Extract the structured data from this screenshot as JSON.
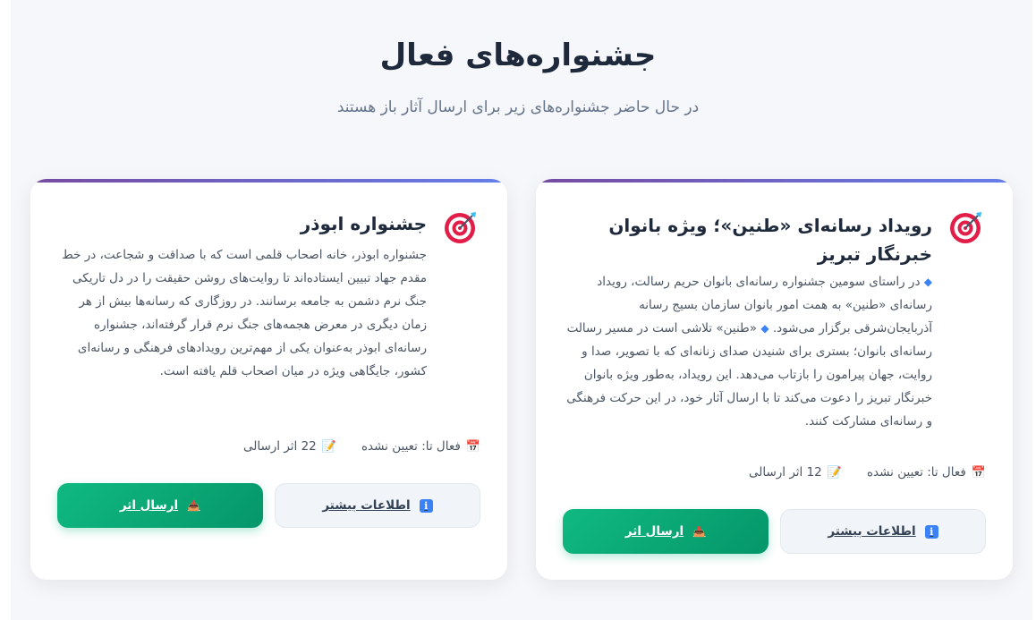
{
  "page": {
    "title": "جشنواره‌های فعال",
    "subtitle": "در حال حاضر جشنواره‌های زیر برای ارسال آثار باز هستند"
  },
  "festivals": [
    {
      "icon": "target-icon",
      "title": "رویداد رسانه‌ای «طنین»؛ ویژه بانوان خبرنگار تبریز",
      "desc_part1": "در راستای سومین جشنواره رسانه‌ای بانوان حریم رسالت، رویداد رسانه‌ای «طنین» به همت امور بانوان سازمان بسیج رسانه آذربایجان‌شرقی برگزار می‌شود.",
      "desc_part2": "«طنین» تلاشی است در مسیر رسالت رسانه‌ای بانوان؛ بستری برای شنیدن صدای زنانه‌ای که با تصویر، صدا و روایت، جهان پیرامون را بازتاب می‌دهد. این رویداد، به‌طور ویژه بانوان خبرنگار تبریز را دعوت می‌کند تا با ارسال آثار خود، در این حرکت فرهنگی و رسانه‌ای مشارکت کنند.",
      "active_until": "فعال تا: تعیین نشده",
      "submissions": "12 اثر ارسالی",
      "info_button": "اطلاعات بیشتر",
      "submit_button": "ارسال اثر"
    },
    {
      "icon": "target-icon",
      "title": "جشنواره ابوذر",
      "desc": "جشنواره ابوذر، خانه اصحاب قلمی است که با صداقت و شجاعت، در خط مقدم جهاد تبیین ایستاده‌اند تا روایت‌های روشن حقیقت را در دل تاریکی جنگ نرم دشمن به جامعه برسانند. در روزگاری که رسانه‌ها بیش از هر زمان دیگری در معرض هجمه‌های جنگ نرم قرار گرفته‌اند، جشنواره رسانه‌ای ابوذر به‌عنوان یکی از مهم‌ترین رویدادهای فرهنگی و رسانه‌ای کشور، جایگاهی ویژه در میان اصحاب قلم یافته است.",
      "active_until": "فعال تا: تعیین نشده",
      "submissions": "22 اثر ارسالی",
      "info_button": "اطلاعات بیشتر",
      "submit_button": "ارسال اثر"
    }
  ],
  "icons": {
    "calendar": "📅",
    "memo": "📝",
    "info": "i",
    "inbox": "📥",
    "diamond": "◆"
  },
  "colors": {
    "accent_gradient_start": "#667eea",
    "accent_gradient_end": "#764ba2",
    "submit_green": "#10b981",
    "title": "#1e293b"
  }
}
